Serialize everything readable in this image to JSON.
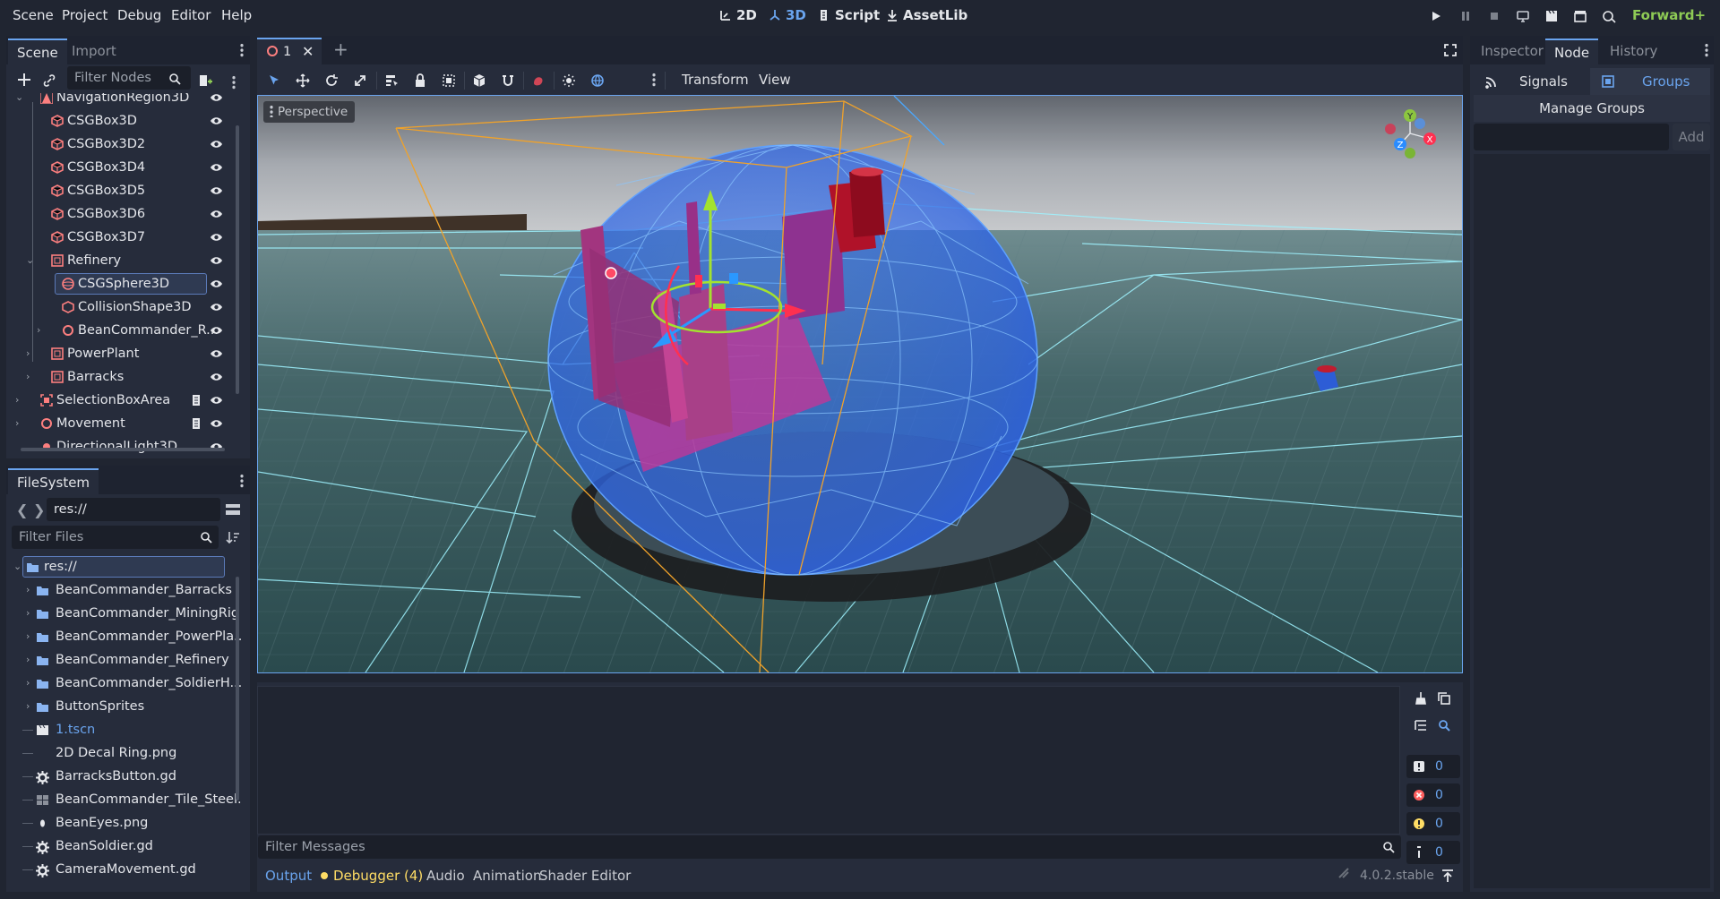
{
  "menubar": {
    "items": [
      "Scene",
      "Project",
      "Debug",
      "Editor",
      "Help"
    ]
  },
  "workspaces": {
    "w2d": "2D",
    "w3d": "3D",
    "script": "Script",
    "assetlib": "AssetLib"
  },
  "renderer": "Forward+",
  "scene_dock": {
    "tabs": [
      "Scene",
      "Import"
    ],
    "filter_placeholder": "Filter Nodes",
    "nodes": [
      {
        "label": "NavigationRegion3D",
        "icon": "navregion-icon",
        "indent": 1,
        "arrow": "v"
      },
      {
        "label": "CSGBox3D",
        "icon": "csgbox-icon",
        "indent": 2
      },
      {
        "label": "CSGBox3D2",
        "icon": "csgbox-icon",
        "indent": 2
      },
      {
        "label": "CSGBox3D4",
        "icon": "csgbox-icon",
        "indent": 2
      },
      {
        "label": "CSGBox3D5",
        "icon": "csgbox-icon",
        "indent": 2
      },
      {
        "label": "CSGBox3D6",
        "icon": "csgbox-icon",
        "indent": 2
      },
      {
        "label": "CSGBox3D7",
        "icon": "csgbox-icon",
        "indent": 2
      },
      {
        "label": "Refinery",
        "icon": "node3d-icon",
        "indent": 2,
        "arrow": "v"
      },
      {
        "label": "CSGSphere3D",
        "icon": "csgsphere-icon",
        "indent": 3,
        "selected": true
      },
      {
        "label": "CollisionShape3D",
        "icon": "collision-icon",
        "indent": 3
      },
      {
        "label": "BeanCommander_R...",
        "icon": "node3d-circle-icon",
        "indent": 3,
        "arrow": ">"
      },
      {
        "label": "PowerPlant",
        "icon": "node3d-icon",
        "indent": 2,
        "arrow": ">"
      },
      {
        "label": "Barracks",
        "icon": "node3d-icon",
        "indent": 2,
        "arrow": ">"
      },
      {
        "label": "SelectionBoxArea",
        "icon": "area-icon",
        "indent": 1,
        "arrow": ">",
        "script": true
      },
      {
        "label": "Movement",
        "icon": "node3d-circle-icon",
        "indent": 1,
        "arrow": ">",
        "script": true
      },
      {
        "label": "DirectionalLight3D",
        "icon": "light-icon",
        "indent": 1
      }
    ]
  },
  "filesystem": {
    "title": "FileSystem",
    "path": "res://",
    "filter_placeholder": "Filter Files",
    "items": [
      {
        "label": "res://",
        "type": "root"
      },
      {
        "label": "BeanCommander_Barracks",
        "type": "folder"
      },
      {
        "label": "BeanCommander_MiningRig",
        "type": "folder"
      },
      {
        "label": "BeanCommander_PowerPla...",
        "type": "folder"
      },
      {
        "label": "BeanCommander_Refinery",
        "type": "folder"
      },
      {
        "label": "BeanCommander_SoldierH...",
        "type": "folder"
      },
      {
        "label": "ButtonSprites",
        "type": "folder"
      },
      {
        "label": "1.tscn",
        "type": "scene"
      },
      {
        "label": "2D Decal Ring.png",
        "type": "image"
      },
      {
        "label": "BarracksButton.gd",
        "type": "script"
      },
      {
        "label": "BeanCommander_Tile_Steel...",
        "type": "texture"
      },
      {
        "label": "BeanEyes.png",
        "type": "image2"
      },
      {
        "label": "BeanSoldier.gd",
        "type": "script"
      },
      {
        "label": "CameraMovement.gd",
        "type": "script"
      }
    ]
  },
  "editor_tab": {
    "label": "1"
  },
  "viewport": {
    "menus": [
      "Transform",
      "View"
    ],
    "perspective": "Perspective",
    "gizmo": {
      "y": "Y",
      "x": "X",
      "z": "Z"
    }
  },
  "output": {
    "filter_placeholder": "Filter Messages",
    "counts": [
      {
        "kind": "message",
        "value": "0",
        "color": "#e6e8ec"
      },
      {
        "kind": "error",
        "value": "0",
        "color": "#ff5f5f"
      },
      {
        "kind": "warning",
        "value": "0",
        "color": "#ffdd65"
      },
      {
        "kind": "info",
        "value": "0",
        "color": "#e6e8ec"
      }
    ]
  },
  "bottom_tabs": [
    {
      "label": "Output",
      "active": true
    },
    {
      "label": "Debugger (4)",
      "dot": true
    },
    {
      "label": "Audio"
    },
    {
      "label": "Animation"
    },
    {
      "label": "Shader Editor"
    }
  ],
  "version": "4.0.2.stable",
  "right_dock": {
    "tabs": [
      "Inspector",
      "Node",
      "History"
    ],
    "signals": "Signals",
    "groups": "Groups",
    "manage_groups": "Manage Groups",
    "add": "Add"
  },
  "colors": {
    "accent": "#6aa4ee",
    "csg": "#fc7f7f",
    "renderer": "#8ecb55",
    "warning": "#ffdd65"
  }
}
